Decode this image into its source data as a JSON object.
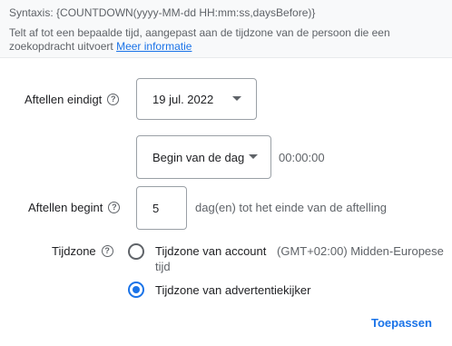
{
  "header": {
    "syntax": "Syntaxis: {COUNTDOWN(yyyy-MM-dd HH:mm:ss,daysBefore)}",
    "description": "Telt af tot een bepaalde tijd, aangepast aan de tijdzone van de persoon die een zoekopdracht uitvoert",
    "more_info_link": "Meer informatie"
  },
  "end": {
    "label": "Aftellen eindigt",
    "help_icon": "help-icon",
    "date_value": "19 jul. 2022",
    "time_option": "Begin van de dag",
    "time_value": "00:00:00"
  },
  "start": {
    "label": "Aftellen begint",
    "help_icon": "help-icon",
    "days_value": "5",
    "suffix": "dag(en) tot het einde van de aftelling"
  },
  "timezone": {
    "label": "Tijdzone",
    "help_icon": "help-icon",
    "options": [
      {
        "label": "Tijdzone van account",
        "detail_line1": "(GMT+02:00) Midden-Europese",
        "detail_line2": "tijd",
        "selected": false
      },
      {
        "label": "Tijdzone van advertentiekijker",
        "selected": true
      }
    ]
  },
  "footer": {
    "apply_label": "Toepassen"
  },
  "colors": {
    "accent": "#1a73e8",
    "text": "#202124",
    "secondary_text": "#5f6368"
  }
}
